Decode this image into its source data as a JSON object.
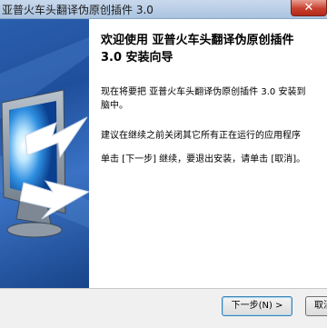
{
  "window": {
    "title": "亚普火车头翻译伪原创插件 3.0",
    "close_symbol": "✕"
  },
  "content": {
    "heading_line1": "欢迎使用 亚普火车头翻译伪原创插件",
    "heading_line2": "3.0 安装向导",
    "para1_line1": "现在将要把 亚普火车头翻译伪原创插件 3.0 安装到",
    "para1_line2": "脑中。",
    "para2": "建议在继续之前关闭其它所有正在运行的应用程序",
    "para3": "单击 [下一步] 继续，要退出安装，请单击 [取消]。"
  },
  "buttons": {
    "next_label": "下一步(N) >",
    "cancel_label": "取消"
  },
  "icons": {
    "side_image": "computer-monitor-with-arrow",
    "close": "close-icon"
  },
  "colors": {
    "close_button": "#c7402e",
    "side_panel": "#1f4f9c"
  }
}
